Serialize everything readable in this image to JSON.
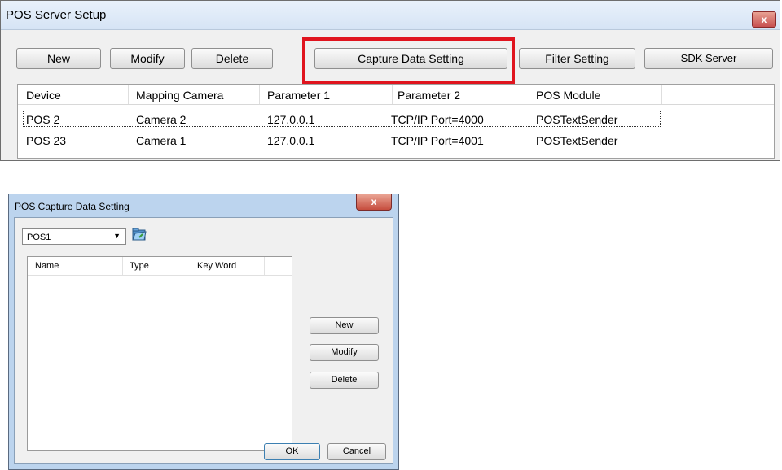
{
  "window1": {
    "title": "POS Server Setup",
    "close_glyph": "x",
    "toolbar": {
      "new_label": "New",
      "modify_label": "Modify",
      "delete_label": "Delete",
      "capture_label": "Capture Data Setting",
      "filter_label": "Filter Setting",
      "sdk_label": "SDK Server"
    },
    "table": {
      "columns": [
        "Device",
        "Mapping Camera",
        "Parameter 1",
        "Parameter 2",
        "POS Module"
      ],
      "rows": [
        [
          "POS 2",
          "Camera 2",
          "127.0.0.1",
          "TCP/IP Port=4000",
          "POSTextSender"
        ],
        [
          "POS 23",
          "Camera 1",
          "127.0.0.1",
          "TCP/IP Port=4001",
          "POSTextSender"
        ]
      ]
    },
    "highlight_color": "#e0141e"
  },
  "window2": {
    "title": "POS Capture Data Setting",
    "close_glyph": "x",
    "device_select": {
      "value": "POS1"
    },
    "table": {
      "columns": [
        "Name",
        "Type",
        "Key Word"
      ]
    },
    "buttons": {
      "new_label": "New",
      "modify_label": "Modify",
      "delete_label": "Delete",
      "ok_label": "OK",
      "cancel_label": "Cancel"
    },
    "icons": {
      "browse": "folder-icon",
      "dropdown": "chevron-down-icon"
    }
  }
}
